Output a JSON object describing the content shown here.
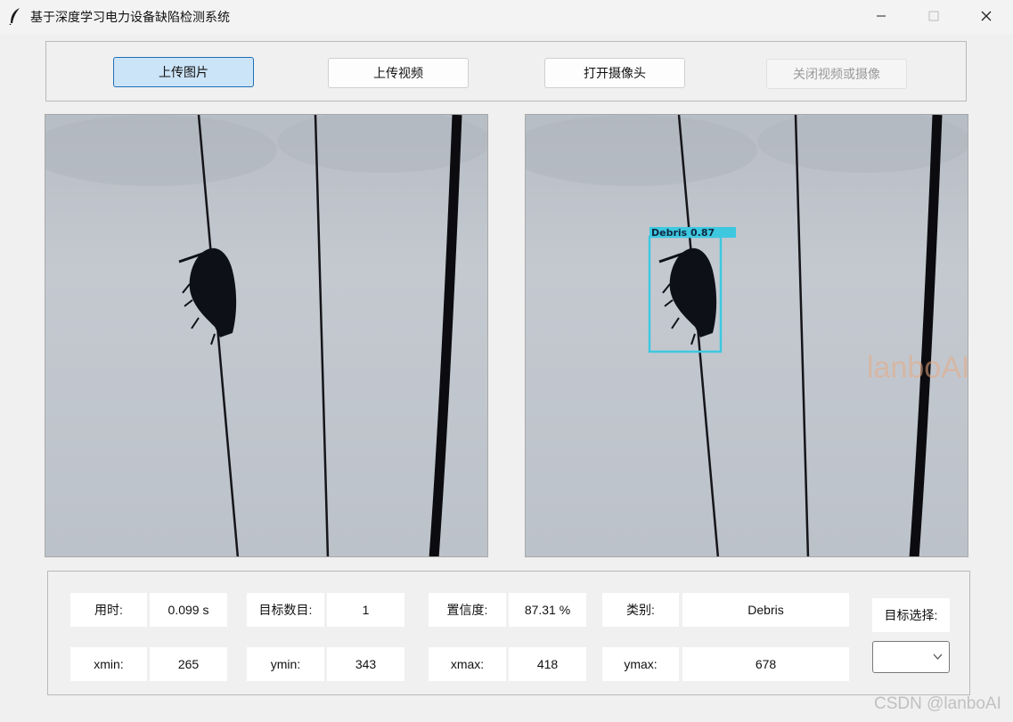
{
  "window": {
    "title": "基于深度学习电力设备缺陷检测系统"
  },
  "controls": {
    "upload_image": "上传图片",
    "upload_video": "上传视频",
    "open_camera": "打开摄像头",
    "close_video_camera": "关闭视频或摄像"
  },
  "detection": {
    "label": "Debris 0.87"
  },
  "stats": {
    "time_label": "用时:",
    "time_value": "0.099 s",
    "count_label": "目标数目:",
    "count_value": "1",
    "conf_label": "置信度:",
    "conf_value": "87.31 %",
    "class_label": "类别:",
    "class_value": "Debris",
    "xmin_label": "xmin:",
    "xmin_value": "265",
    "ymin_label": "ymin:",
    "ymin_value": "343",
    "xmax_label": "xmax:",
    "xmax_value": "418",
    "ymax_label": "ymax:",
    "ymax_value": "678",
    "target_select_label": "目标选择:",
    "target_select_value": ""
  },
  "watermarks": {
    "image": "lanboAI",
    "footer": "CSDN @lanboAI"
  },
  "icons": {
    "app": "feather-icon",
    "minimize": "minimize-icon",
    "maximize": "maximize-icon",
    "close": "close-icon",
    "dropdown": "chevron-down-icon"
  },
  "colors": {
    "detection_box": "#3dc8e0",
    "primary_button": "#cce4f7",
    "primary_border": "#1f6fb5"
  }
}
